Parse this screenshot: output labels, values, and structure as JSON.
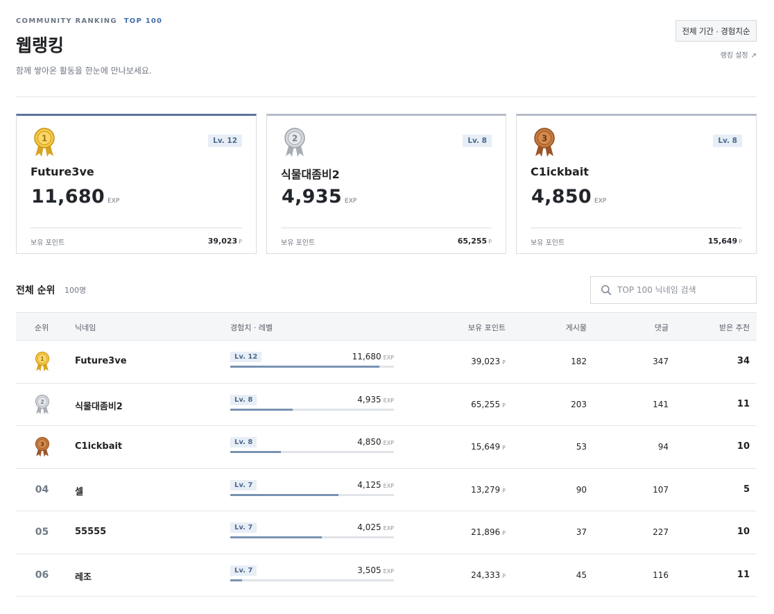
{
  "header": {
    "eyebrow": "COMMUNITY RANKING",
    "eyebrow_tag": "TOP 100",
    "title": "웹랭킹",
    "subtitle": "함께 쌓아온 활동을 한눈에 만나보세요.",
    "filter_button": "전체 기간 · 경험치순",
    "settings_link": "랭킹 설정",
    "settings_arrow": "↗"
  },
  "podium": [
    {
      "rank": 1,
      "level": "Lv. 12",
      "name": "Future3ve",
      "exp": "11,680",
      "exp_unit": "EXP",
      "points_label": "보유 포인트",
      "points": "39,023",
      "points_unit": "P"
    },
    {
      "rank": 2,
      "level": "Lv. 8",
      "name": "식물대좀비2",
      "exp": "4,935",
      "exp_unit": "EXP",
      "points_label": "보유 포인트",
      "points": "65,255",
      "points_unit": "P"
    },
    {
      "rank": 3,
      "level": "Lv. 8",
      "name": "C1ickbait",
      "exp": "4,850",
      "exp_unit": "EXP",
      "points_label": "보유 포인트",
      "points": "15,649",
      "points_unit": "P"
    }
  ],
  "list": {
    "title": "전체 순위",
    "count": "100명",
    "search_placeholder": "TOP 100 닉네임 검색",
    "columns": {
      "rank": "순위",
      "nickname": "닉네임",
      "exp_level": "경험치 · 레벨",
      "points": "보유 포인트",
      "posts": "게시물",
      "comments": "댓글",
      "recommends": "받은 추천"
    },
    "rows": [
      {
        "rank": "01",
        "medal": "gold",
        "nickname": "Future3ve",
        "level": "Lv. 12",
        "exp": "11,680",
        "exp_unit": "EXP",
        "progress": 0.91,
        "points": "39,023",
        "points_unit": "P",
        "posts": "182",
        "comments": "347",
        "recommends": "34"
      },
      {
        "rank": "02",
        "medal": "silver",
        "nickname": "식물대좀비2",
        "level": "Lv. 8",
        "exp": "4,935",
        "exp_unit": "EXP",
        "progress": 0.38,
        "points": "65,255",
        "points_unit": "P",
        "posts": "203",
        "comments": "141",
        "recommends": "11"
      },
      {
        "rank": "03",
        "medal": "bronze",
        "nickname": "C1ickbait",
        "level": "Lv. 8",
        "exp": "4,850",
        "exp_unit": "EXP",
        "progress": 0.31,
        "points": "15,649",
        "points_unit": "P",
        "posts": "53",
        "comments": "94",
        "recommends": "10"
      },
      {
        "rank": "04",
        "medal": "",
        "nickname": "셀",
        "level": "Lv. 7",
        "exp": "4,125",
        "exp_unit": "EXP",
        "progress": 0.66,
        "points": "13,279",
        "points_unit": "P",
        "posts": "90",
        "comments": "107",
        "recommends": "5"
      },
      {
        "rank": "05",
        "medal": "",
        "nickname": "55555",
        "level": "Lv. 7",
        "exp": "4,025",
        "exp_unit": "EXP",
        "progress": 0.56,
        "points": "21,896",
        "points_unit": "P",
        "posts": "37",
        "comments": "227",
        "recommends": "10"
      },
      {
        "rank": "06",
        "medal": "",
        "nickname": "레조",
        "level": "Lv. 7",
        "exp": "3,505",
        "exp_unit": "EXP",
        "progress": 0.07,
        "points": "24,333",
        "points_unit": "P",
        "posts": "45",
        "comments": "116",
        "recommends": "11"
      }
    ]
  },
  "icons": {
    "medal_gold": "gold-medal-icon",
    "medal_silver": "silver-medal-icon",
    "medal_bronze": "bronze-medal-icon",
    "search": "search-icon"
  },
  "colors": {
    "accent": "#5b7699",
    "badge_bg": "#e8eef5",
    "badge_text": "#4a6a91",
    "bar_fill": "#7892b1",
    "gold": "#e9b431",
    "silver": "#bfc3c8",
    "bronze": "#b26a35"
  }
}
